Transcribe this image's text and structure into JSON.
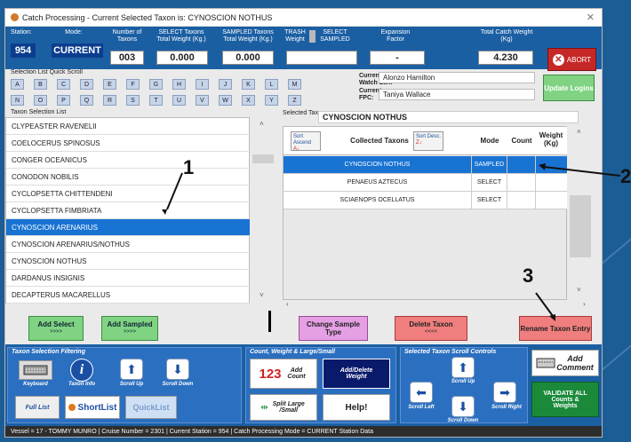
{
  "window": {
    "title": "Catch Processing - Current Selected Taxon is: CYNOSCION NOTHUS",
    "close": "✕"
  },
  "header": {
    "station_label": "Station:",
    "station": "954",
    "mode_label": "Mode:",
    "mode": "CURRENT",
    "num_taxons_label": "Number of Taxons",
    "num_taxons": "003",
    "select_weight_label": "SELECT Taxons Total Weight (Kg.)",
    "select_weight": "0.000",
    "sampled_weight_label": "SAMPLED Taxons Total Weight (Kg.)",
    "sampled_weight": "0.000",
    "trash_label": "TRASH Weight",
    "select_sampled_label": "SELECT SAMPLED",
    "expansion_label": "Expansion Factor",
    "expansion": "-",
    "total_catch_label": "Total Catch Weight (Kg)",
    "total_catch": "4.230",
    "abort": "ABORT"
  },
  "quick_scroll": {
    "label": "Selection List Quick Scroll",
    "row1": [
      "A",
      "B",
      "C",
      "D",
      "E",
      "F",
      "G",
      "H",
      "I",
      "J",
      "K",
      "L",
      "M"
    ],
    "row2": [
      "N",
      "O",
      "P",
      "Q",
      "R",
      "S",
      "T",
      "U",
      "V",
      "W",
      "X",
      "Y",
      "Z"
    ]
  },
  "watch": {
    "leader_label": "Current Watch Ldr..",
    "leader": "Alonzo Hamilton",
    "fpc_label": "Current FPC:",
    "fpc": "Taniya Wallace",
    "update": "Update Logins"
  },
  "taxon_list": {
    "label": "Taxon Selection List",
    "items": [
      "CLYPEASTER RAVENELII",
      "COELOCERUS SPINOSUS",
      "CONGER OCEANICUS",
      "CONODON NOBILIS",
      "CYCLOPSETTA CHITTENDENI",
      "CYCLOPSETTA FIMBRIATA",
      "CYNOSCION ARENARIUS",
      "CYNOSCION ARENARIUS/NOTHUS",
      "CYNOSCION NOTHUS",
      "DARDANUS INSIGNIS",
      "DECAPTERUS MACARELLUS"
    ],
    "selected_index": 6
  },
  "selected_taxon": {
    "label": "Selected Taxon:",
    "value": "CYNOSCION NOTHUS"
  },
  "grid": {
    "sort_asc": "Sort Ascend",
    "sort_desc": "Sort Desc.",
    "col_taxons": "Collected Taxons",
    "col_mode": "Mode",
    "col_count": "Count",
    "col_weight": "Weight (Kg)",
    "rows": [
      {
        "taxon": "CYNOSCION NOTHUS",
        "mode": "SAMPLED"
      },
      {
        "taxon": "PENAEUS AZTECUS",
        "mode": "SELECT"
      },
      {
        "taxon": "SCIAENOPS OCELLATUS",
        "mode": "SELECT"
      }
    ]
  },
  "actions": {
    "add_select": "Add Select",
    "add_sampled": "Add Sampled",
    "arrows": ">>>>",
    "change_sample": "Change Sample Type",
    "delete_taxon": "Delete Taxon",
    "delete_arrows": "<<<<",
    "rename": "Rename Taxon Entry"
  },
  "bottom": {
    "filter_title": "Taxon Selection Filtering",
    "keyboard": "Keyboard",
    "taxon_info": "Taxon Info",
    "scroll_up": "Scroll Up",
    "scroll_down": "Scroll Down",
    "full_list": "Full List",
    "shortlist": "ShortList",
    "quicklist": "QuickList",
    "cw_title": "Count, Weight & Large/Small",
    "add_count": "Add Count",
    "add_delete_weight": "Add/Delete Weight",
    "split": "Split Large /Small",
    "help": "Help!",
    "scroll_title": "Selected Taxon Scroll Controls",
    "scroll_left": "Scroll Left",
    "scroll_right": "Scroll Right",
    "sup": "Scroll Up",
    "sdown": "Scroll Down",
    "add_comment": "Add Comment",
    "validate": "VALIDATE ALL Counts & Weights"
  },
  "status": "Vessel = 17 - TOMMY MUNRO  |  Cruise Number = 2301  |  Current Station = 954  |  Catch Processing Mode = CURRENT Station Data",
  "annotations": [
    "1",
    "2",
    "3"
  ]
}
